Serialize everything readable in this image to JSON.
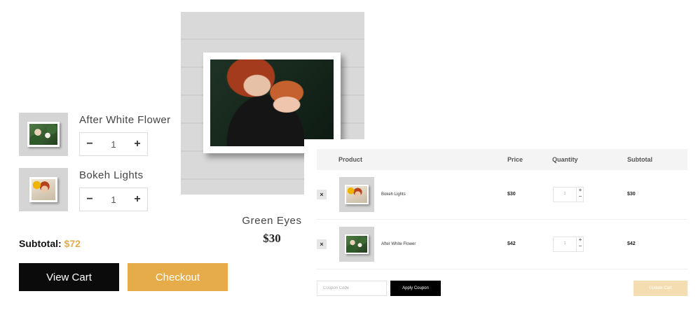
{
  "mini_cart": {
    "items": [
      {
        "name": "After White Flower",
        "qty": "1",
        "image_icon": "framed-flower-photo"
      },
      {
        "name": "Bokeh Lights",
        "qty": "1",
        "image_icon": "framed-portrait-photo"
      }
    ],
    "minus_label": "−",
    "plus_label": "+",
    "subtotal_label": "Subtotal:",
    "subtotal_value": "$72",
    "view_cart_label": "View Cart",
    "checkout_label": "Checkout"
  },
  "featured": {
    "name": "Green Eyes",
    "price": "$30"
  },
  "cart_table": {
    "headers": {
      "product": "Product",
      "price": "Price",
      "quantity": "Quantity",
      "subtotal": "Subtotal"
    },
    "remove_label": "×",
    "rows": [
      {
        "name": "Bokeh Lights",
        "price": "$30",
        "qty": "1",
        "subtotal": "$30"
      },
      {
        "name": "After White Flower",
        "price": "$42",
        "qty": "1",
        "subtotal": "$42"
      }
    ],
    "plus_label": "+",
    "minus_label": "−",
    "coupon_placeholder": "Coupon Code",
    "apply_label": "Apply Coupon",
    "update_label": "Update Cart"
  },
  "colors": {
    "accent": "#e5ac49",
    "dark": "#0b0b0b",
    "update_disabled": "#f3ddb1"
  }
}
